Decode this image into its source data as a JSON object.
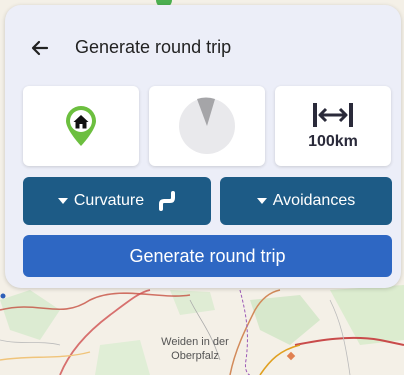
{
  "header": {
    "title": "Generate round trip",
    "back_icon": "arrow-left-icon"
  },
  "options": {
    "start_icon": "home-pin-icon",
    "direction_icon": "direction-pie-icon",
    "distance_icon": "width-arrows-icon",
    "distance_label": "100km"
  },
  "actions": {
    "curvature_label": "Curvature",
    "curvature_icon": "curvy-road-icon",
    "avoidances_label": "Avoidances",
    "generate_label": "Generate round trip"
  },
  "map": {
    "place_label_line1": "Weiden in der",
    "place_label_line2": "Oberpfalz"
  },
  "colors": {
    "panel_bg": "#eceef8",
    "dark_button": "#1d5b86",
    "primary_button": "#2e67c3",
    "pin_green": "#6cbf3f"
  }
}
